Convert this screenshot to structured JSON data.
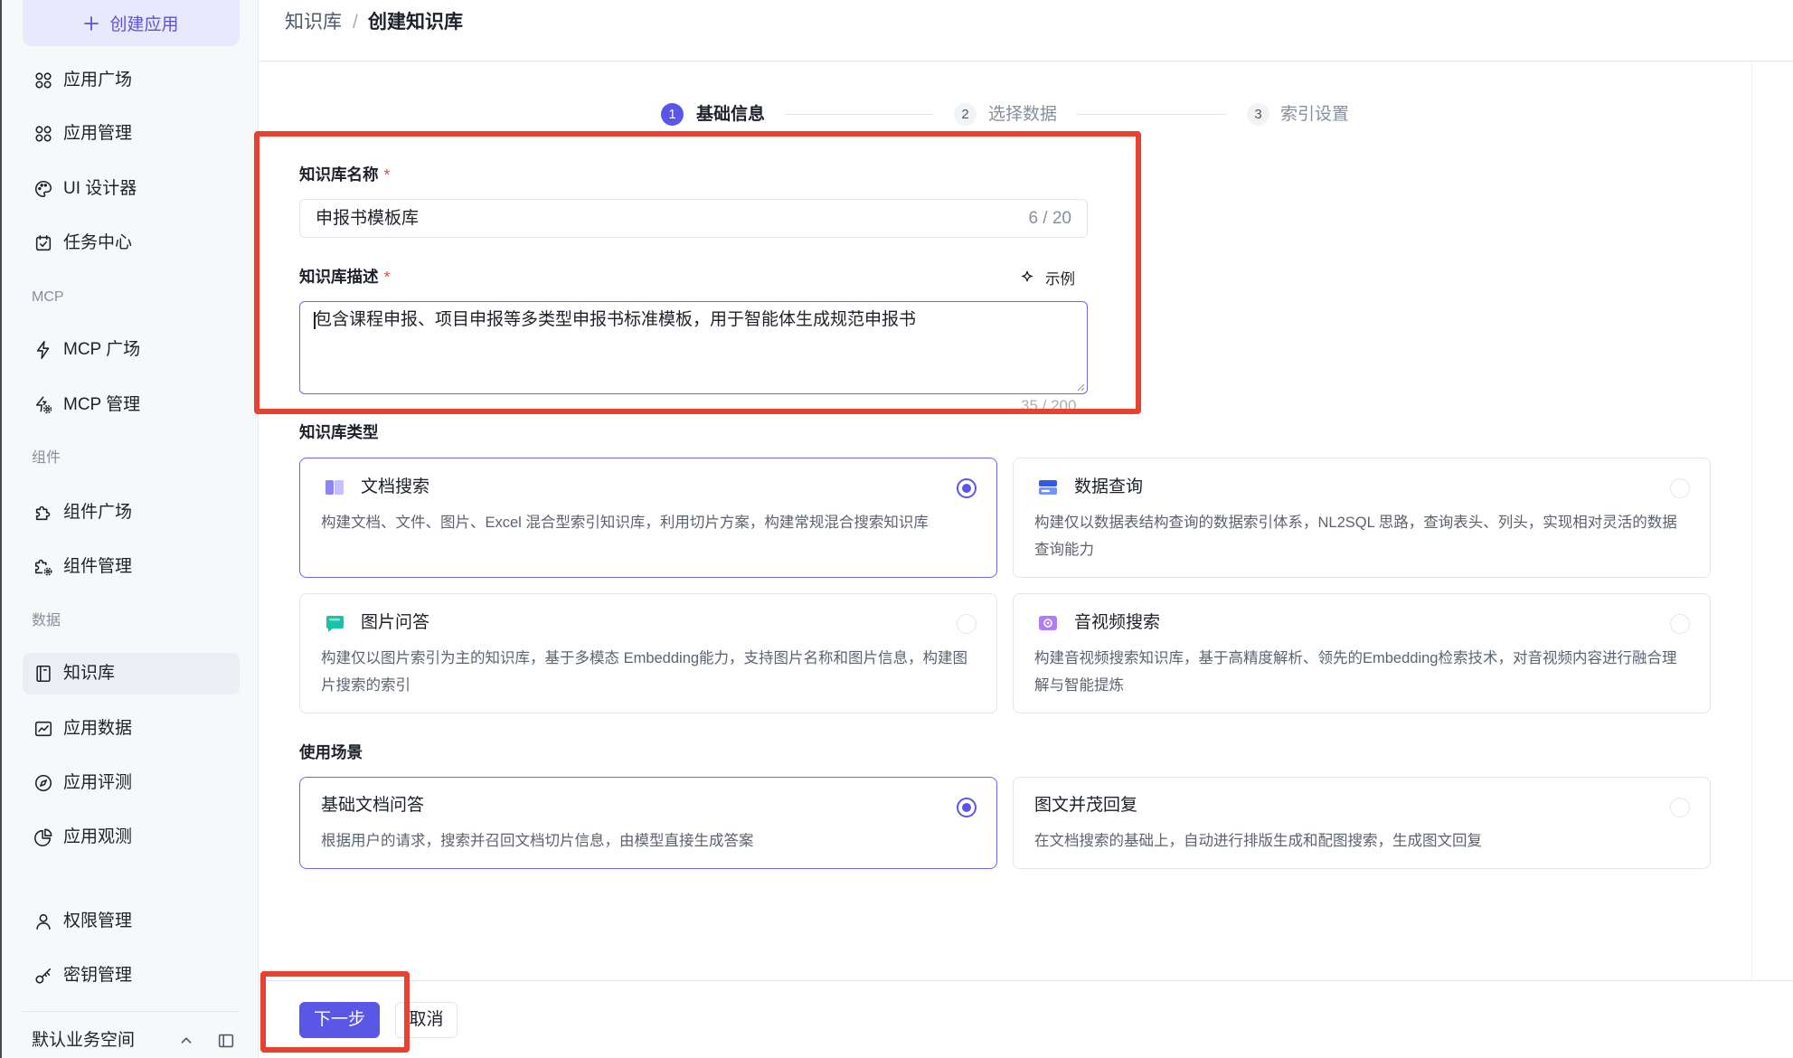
{
  "colors": {
    "accent": "#5b57e6",
    "annotation": "#e8412f"
  },
  "sidebar": {
    "create_label": "创建应用",
    "items": [
      {
        "label": "应用广场",
        "icon": "app-square-icon",
        "active": false
      },
      {
        "label": "应用管理",
        "icon": "app-manage-icon",
        "active": false
      },
      {
        "label": "UI 设计器",
        "icon": "palette-icon",
        "active": false
      },
      {
        "label": "任务中心",
        "icon": "task-icon",
        "active": false
      },
      {
        "label": "MCP 广场",
        "icon": "lightning-icon",
        "active": false
      },
      {
        "label": "MCP 管理",
        "icon": "lightning-settings-icon",
        "active": false
      },
      {
        "label": "组件广场",
        "icon": "puzzle-icon",
        "active": false
      },
      {
        "label": "组件管理",
        "icon": "puzzle-settings-icon",
        "active": false
      },
      {
        "label": "知识库",
        "icon": "book-icon",
        "active": true
      },
      {
        "label": "应用数据",
        "icon": "chart-icon",
        "active": false
      },
      {
        "label": "应用评测",
        "icon": "compass-icon",
        "active": false
      },
      {
        "label": "应用观测",
        "icon": "pie-chart-icon",
        "active": false
      },
      {
        "label": "权限管理",
        "icon": "user-icon",
        "active": false
      },
      {
        "label": "密钥管理",
        "icon": "key-icon",
        "active": false
      }
    ],
    "section_labels": {
      "mcp": "MCP",
      "components": "组件",
      "data": "数据"
    },
    "workspace": "默认业务空间"
  },
  "header": {
    "breadcrumb_root": "知识库",
    "separator": "/",
    "breadcrumb_current": "创建知识库"
  },
  "steps": [
    {
      "number": "1",
      "label": "基础信息",
      "active": true
    },
    {
      "number": "2",
      "label": "选择数据",
      "active": false
    },
    {
      "number": "3",
      "label": "索引设置",
      "active": false
    }
  ],
  "form": {
    "name": {
      "label": "知识库名称",
      "required_mark": "*",
      "value": "申报书模板库",
      "counter": "6 / 20"
    },
    "description": {
      "label": "知识库描述",
      "required_mark": "*",
      "example_label": "示例",
      "value": "包含课程申报、项目申报等多类型申报书标准模板，用于智能体生成规范申报书",
      "counter": "35 / 200"
    },
    "kb_type_label": "知识库类型",
    "kb_types": [
      {
        "title": "文档搜索",
        "icon": "doc-search-icon",
        "selected": true,
        "desc": "构建文档、文件、图片、Excel 混合型索引知识库，利用切片方案，构建常规混合搜索知识库"
      },
      {
        "title": "数据查询",
        "icon": "data-query-icon",
        "selected": false,
        "desc": "构建仅以数据表结构查询的数据索引体系，NL2SQL 思路，查询表头、列头，实现相对灵活的数据查询能力"
      },
      {
        "title": "图片问答",
        "icon": "image-qa-icon",
        "selected": false,
        "desc": "构建仅以图片索引为主的知识库，基于多模态 Embedding能力，支持图片名称和图片信息，构建图片搜索的索引"
      },
      {
        "title": "音视频搜索",
        "icon": "av-search-icon",
        "selected": false,
        "desc": "构建音视频搜索知识库，基于高精度解析、领先的Embedding检索技术，对音视频内容进行融合理解与智能提炼"
      }
    ],
    "scene_label": "使用场景",
    "scenes": [
      {
        "title": "基础文档问答",
        "selected": true,
        "desc": "根据用户的请求，搜索并召回文档切片信息，由模型直接生成答案"
      },
      {
        "title": "图文并茂回复",
        "selected": false,
        "desc": "在文档搜索的基础上，自动进行排版生成和配图搜索，生成图文回复"
      }
    ]
  },
  "footer": {
    "next_label": "下一步",
    "cancel_label": "取消"
  }
}
